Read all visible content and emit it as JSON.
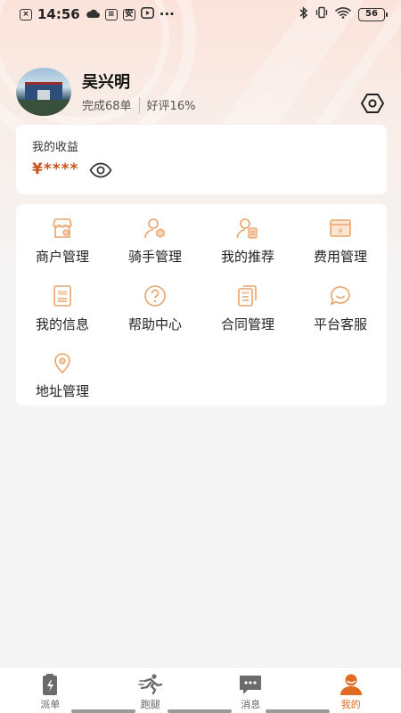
{
  "status_bar": {
    "time": "14:56",
    "more": "···",
    "battery": "56",
    "icons": [
      "close-box-icon",
      "cloud-icon",
      "sim-icon",
      "app-icon",
      "play-icon",
      "bluetooth-icon",
      "wifi-icon"
    ]
  },
  "profile": {
    "name": "吴兴明",
    "completed": "完成68单",
    "rating": "好评16%"
  },
  "earnings": {
    "title": "我的收益",
    "amount": "¥****"
  },
  "menu": {
    "items": [
      {
        "label": "商户管理",
        "icon": "shop-icon"
      },
      {
        "label": "骑手管理",
        "icon": "rider-icon"
      },
      {
        "label": "我的推荐",
        "icon": "recommend-icon"
      },
      {
        "label": "费用管理",
        "icon": "fee-icon"
      },
      {
        "label": "我的信息",
        "icon": "info-icon"
      },
      {
        "label": "帮助中心",
        "icon": "help-icon"
      },
      {
        "label": "合同管理",
        "icon": "contract-icon"
      },
      {
        "label": "平台客服",
        "icon": "service-icon"
      },
      {
        "label": "地址管理",
        "icon": "location-icon"
      }
    ]
  },
  "tabs": [
    {
      "label": "派单",
      "icon": "dispatch-icon",
      "active": false
    },
    {
      "label": "跑腿",
      "icon": "errand-icon",
      "active": false
    },
    {
      "label": "消息",
      "icon": "message-icon",
      "active": false
    },
    {
      "label": "我的",
      "icon": "profile-icon",
      "active": true
    }
  ],
  "colors": {
    "accent": "#e06a1f",
    "icon_orange": "#e9a36a",
    "amount": "#c8541f"
  }
}
